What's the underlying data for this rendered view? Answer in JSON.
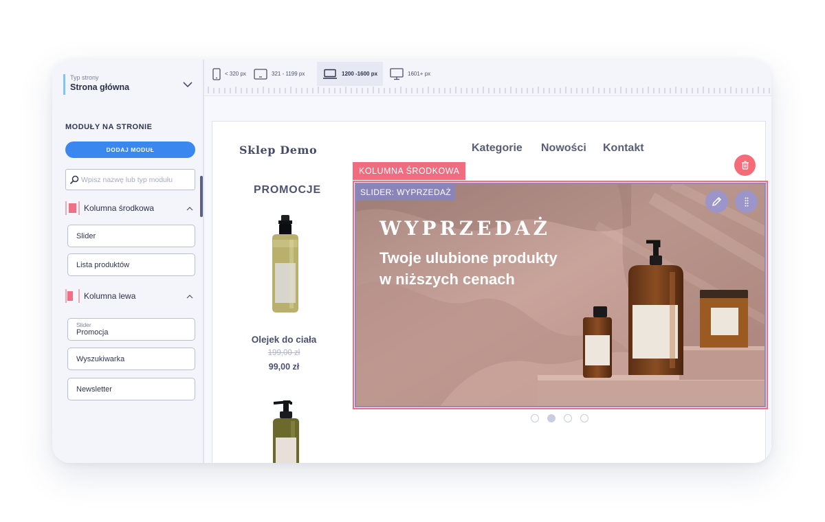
{
  "sidebar": {
    "page_type": {
      "label": "Typ strony",
      "value": "Strona główna"
    },
    "modules_title": "MODUŁY NA STRONIE",
    "add_button": "DODAJ MODUŁ",
    "search_placeholder": "Wpisz nazwę lub typ modułu",
    "groups": [
      {
        "label": "Kolumna środkowa",
        "items": [
          {
            "label": "Slider"
          },
          {
            "label": "Lista produktów"
          }
        ]
      },
      {
        "label": "Kolumna lewa",
        "items": [
          {
            "sublabel": "Slider",
            "label": "Promocja"
          },
          {
            "label": "Wyszukiwarka"
          },
          {
            "label": "Newsletter"
          }
        ]
      }
    ]
  },
  "toolbar": {
    "breakpoints": [
      {
        "label": "< 320 px",
        "icon": "phone-icon"
      },
      {
        "label": "321 - 1199 px",
        "icon": "tablet-icon"
      },
      {
        "label": "1200 -1600 px",
        "icon": "laptop-icon",
        "active": true
      },
      {
        "label": "1601+ px",
        "icon": "desktop-icon"
      }
    ]
  },
  "preview": {
    "logo": "Sklep Demo",
    "nav": [
      "Kategorie",
      "Nowości",
      "Kontakt"
    ],
    "left_column": {
      "title": "PROMOCJE",
      "products": [
        {
          "name": "Olejek do ciała",
          "old_price": "199,00 zł",
          "price": "99,00 zł"
        }
      ]
    },
    "center_column_tag": "KOLUMNA ŚRODKOWA",
    "slider": {
      "tag": "SLIDER: WYPRZEDAŻ",
      "heading": "WYPRZEDAŻ",
      "text": "Twoje ulubione produkty w niższych cenach",
      "dots_count": 4,
      "active_dot": 2
    }
  },
  "colors": {
    "accent_blue": "#3b87f0",
    "column_pink": "#f26c80",
    "slider_purple": "#8a84b9",
    "delete_red": "#f56b78"
  }
}
